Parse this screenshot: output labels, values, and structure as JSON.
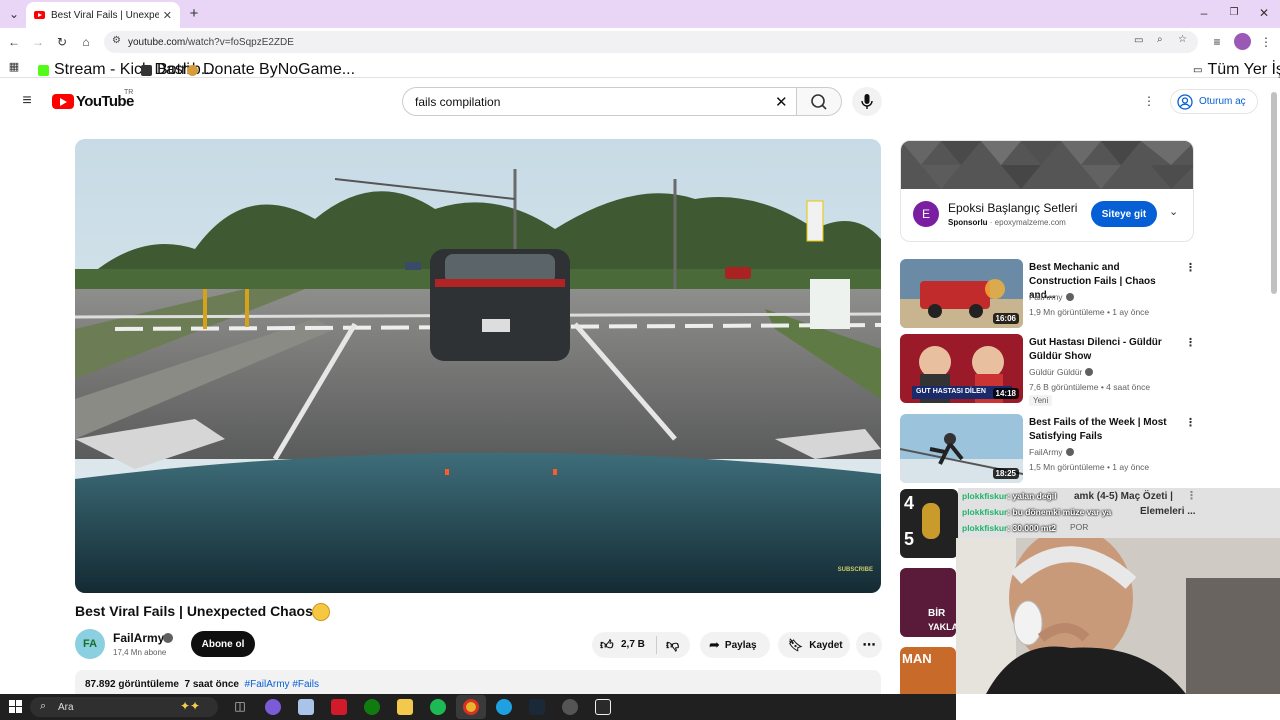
{
  "browser": {
    "tab_title": "Best Viral Fails | Unexpected Ch",
    "url_host": "youtube.com",
    "url_path": "/watch?v=foSqpzE2ZDE",
    "bookmarks": [
      "Stream - Kick Dashb...",
      "Botrix",
      "Donate ByNoGame..."
    ],
    "all_bookmarks": "Tüm Yer İşaretleri"
  },
  "youtube": {
    "logo_text": "YouTube",
    "country": "TR",
    "search_value": "fails compilation",
    "signin_label": "Oturum aç"
  },
  "video": {
    "title": "Best Viral Fails | Unexpected Chaos",
    "channel": "FailArmy",
    "channel_avatar": "FA",
    "subscribers": "17,4 Mn abone",
    "subscribe_label": "Abone ol",
    "likes": "2,7 B",
    "share_label": "Paylaş",
    "save_label": "Kaydet",
    "views": "87.892 görüntüleme",
    "age": "7 saat önce",
    "hashtags": "#FailArmy #Fails",
    "overlay_subscribe": "SUBSCRIBE"
  },
  "ad": {
    "logo_letter": "E",
    "title": "Epoksi Başlangıç Setleri",
    "sponsored": "Sponsorlu",
    "domain": "epoxymalzeme.com",
    "cta": "Siteye git"
  },
  "recommendations": [
    {
      "title": "Best Mechanic and Construction Fails | Chaos and...",
      "channel": "FailArmy",
      "meta": "1,9 Mn görüntüleme • 1 ay önce",
      "duration": "16:06",
      "badge": ""
    },
    {
      "title": "Gut Hastası Dilenci - Güldür Güldür Show",
      "channel": "Güldür Güldür",
      "meta": "7,6 B görüntüleme • 4 saat önce",
      "duration": "14:18",
      "badge": "Yeni",
      "thumb_caption": "GUT HASTASI DİLEN"
    },
    {
      "title": "Best Fails of the Week | Most Satisfying Fails",
      "channel": "FailArmy",
      "meta": "1,5 Mn görüntüleme • 1 ay önce",
      "duration": "18:25",
      "badge": ""
    }
  ],
  "rec_partial": {
    "title_fragment": "amk (4-5) Maç Özeti |",
    "line2_fragment": "Elemeleri ...",
    "channel_fragment": "POR",
    "thumb_score": [
      "4",
      "5"
    ],
    "thumb5_text": [
      "BİR",
      "YAKLAŞ"
    ],
    "thumb6_text": "MAN"
  },
  "chat": [
    {
      "user": "plokkfiskur",
      "msg": ": yalan değil"
    },
    {
      "user": "plokkfiskur",
      "msg": ": bu dönemki müze var ya"
    },
    {
      "user": "plokkfiskur",
      "msg": ": 30.000 mt2"
    }
  ],
  "taskbar": {
    "search_label": "Ara"
  },
  "colors": {
    "youtube_red": "#ff0000",
    "link_blue": "#065fd4",
    "chat_user": "#1fb46e",
    "tab_strip": "#e9d5f5"
  }
}
